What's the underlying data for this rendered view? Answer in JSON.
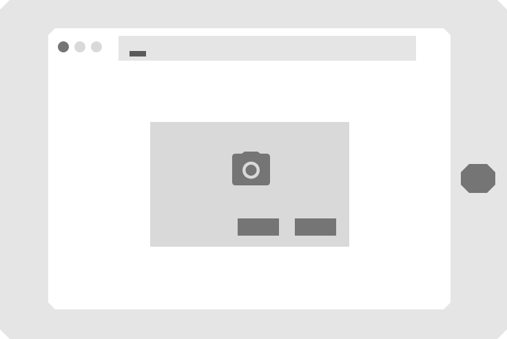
{
  "device": {
    "type": "tablet",
    "frame_color": "#e5e5e5",
    "screen_color": "#ffffff",
    "home_button_color": "#757575"
  },
  "browser": {
    "window_controls": [
      "close-dot",
      "minimize-dot",
      "maximize-dot"
    ],
    "address_bar": {
      "value": ""
    }
  },
  "dialog": {
    "icon": "camera-icon",
    "background": "#d9d9d9",
    "buttons": [
      {
        "label": ""
      },
      {
        "label": ""
      }
    ]
  }
}
